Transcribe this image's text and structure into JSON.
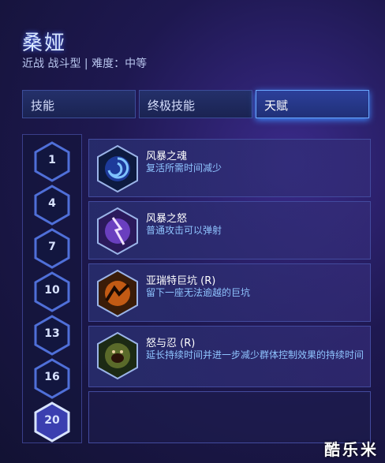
{
  "hero": {
    "name": "桑娅",
    "subtitle": "近战 战斗型 | 难度：中等"
  },
  "tabs": [
    {
      "label": "技能",
      "active": false
    },
    {
      "label": "终极技能",
      "active": false
    },
    {
      "label": "天赋",
      "active": true
    }
  ],
  "tiers": [
    "1",
    "4",
    "7",
    "10",
    "13",
    "16",
    "20"
  ],
  "selected_tier": "20",
  "talents": [
    {
      "name": "风暴之魂",
      "desc": "复活所需时间减少",
      "icon": "storm-soul-icon"
    },
    {
      "name": "风暴之怒",
      "desc": "普通攻击可以弹射",
      "icon": "storm-fury-icon"
    },
    {
      "name": "亚瑞特巨坑 (R)",
      "desc": "留下一座无法逾越的巨坑",
      "icon": "arreat-crater-icon"
    },
    {
      "name": "怒与忍 (R)",
      "desc": "延长持续时间并进一步减少群体控制效果的持续时间",
      "icon": "rage-endurance-icon"
    }
  ],
  "watermark": "酷乐米",
  "colors": {
    "accent": "#6aa8ff",
    "desc_text": "#8fc4ff",
    "bg": "#1e1850"
  }
}
